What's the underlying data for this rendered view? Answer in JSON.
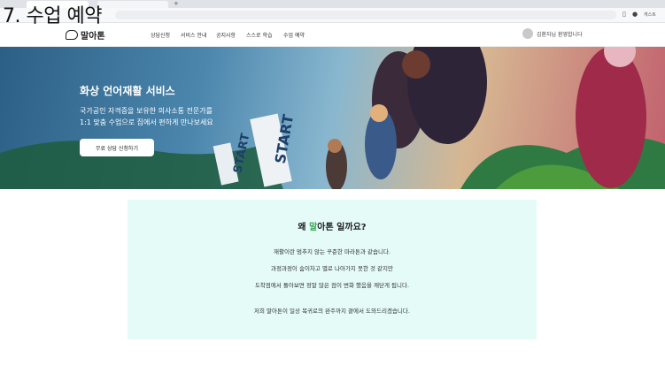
{
  "overlay": {
    "title": "7. 수업 예약"
  },
  "browser": {
    "profile_label": "게스트"
  },
  "header": {
    "logo_text": "말아톤",
    "nav": [
      "상담신청",
      "서비스 안내",
      "공지사항",
      "스스로 학습",
      "수업 예약"
    ],
    "user_text": "김환자님 환영합니다"
  },
  "hero": {
    "title": "화상 언어재활 서비스",
    "subtitle_line1": "국가공인 자격증을 보유한 의사소통 전문가를",
    "subtitle_line2": "1:1 맞춤 수업으로 집에서 편하게 만나보세요",
    "cta_label": "무료 상담 신청하기",
    "sign1": "START",
    "sign2": "START"
  },
  "why": {
    "title_prefix": "왜 ",
    "title_accent": "말",
    "title_suffix": "아톤 일까요?",
    "lines": [
      "재활이란 멈추지 않는 꾸준한 마라톤과 같습니다.",
      "과정과정이 숨이차고 별로 나아가지 못한 것 같지만",
      "도착점에서 돌아보면 정말 많은 점이 변화 했음을 깨닫게 됩니다.",
      "저희 말아톤이 일상 복귀로의 완주까지 곁에서 도와드리겠습니다."
    ]
  },
  "colors": {
    "accent": "#3aa655",
    "panel_bg": "#e4fbf7"
  }
}
